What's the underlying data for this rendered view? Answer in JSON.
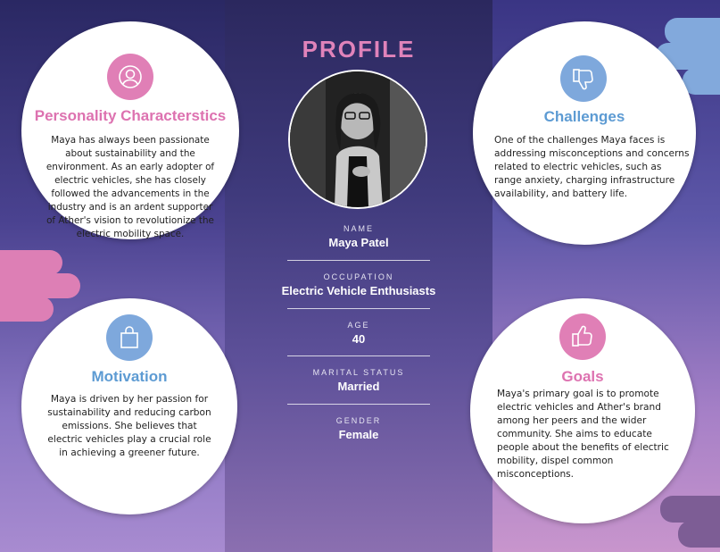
{
  "header": {
    "title": "PROFILE"
  },
  "colors": {
    "pink": "#e07fb6",
    "blue": "#7ea8dc",
    "pink_text": "#dd72b0",
    "blue_text": "#5d9bd3"
  },
  "photo": {
    "alt": "Maya Patel portrait",
    "icon": "person-photo"
  },
  "fields": [
    {
      "label": "NAME",
      "value": "Maya Patel"
    },
    {
      "label": "OCCUPATION",
      "value": "Electric Vehicle Enthusiasts"
    },
    {
      "label": "AGE",
      "value": "40"
    },
    {
      "label": "MARITAL STATUS",
      "value": "Married"
    },
    {
      "label": "GENDER",
      "value": "Female"
    }
  ],
  "personality": {
    "icon": "person-icon",
    "title": "Personality Characterstics",
    "text": "Maya has always been passionate about sustainability and the environment. As an early adopter of electric vehicles, she has closely followed the advancements in the industry and is an ardent supporter of Ather's vision to revolutionize the electric mobility space."
  },
  "motivation": {
    "icon": "shopping-bag-icon",
    "title": "Motivation",
    "text": "Maya is driven by her passion for sustainability and reducing carbon emissions. She believes that electric vehicles play a crucial role in achieving a greener future."
  },
  "challenges": {
    "icon": "thumbs-down-icon",
    "title": "Challenges",
    "text": "One of the challenges Maya faces is addressing misconceptions and concerns related to electric vehicles, such as range anxiety, charging infrastructure availability, and battery life."
  },
  "goals": {
    "icon": "thumbs-up-icon",
    "title": "Goals",
    "text": "Maya's primary goal is to promote electric vehicles and Ather's brand among her peers and the wider community. She aims to educate people about the benefits of electric mobility, dispel common misconceptions."
  }
}
